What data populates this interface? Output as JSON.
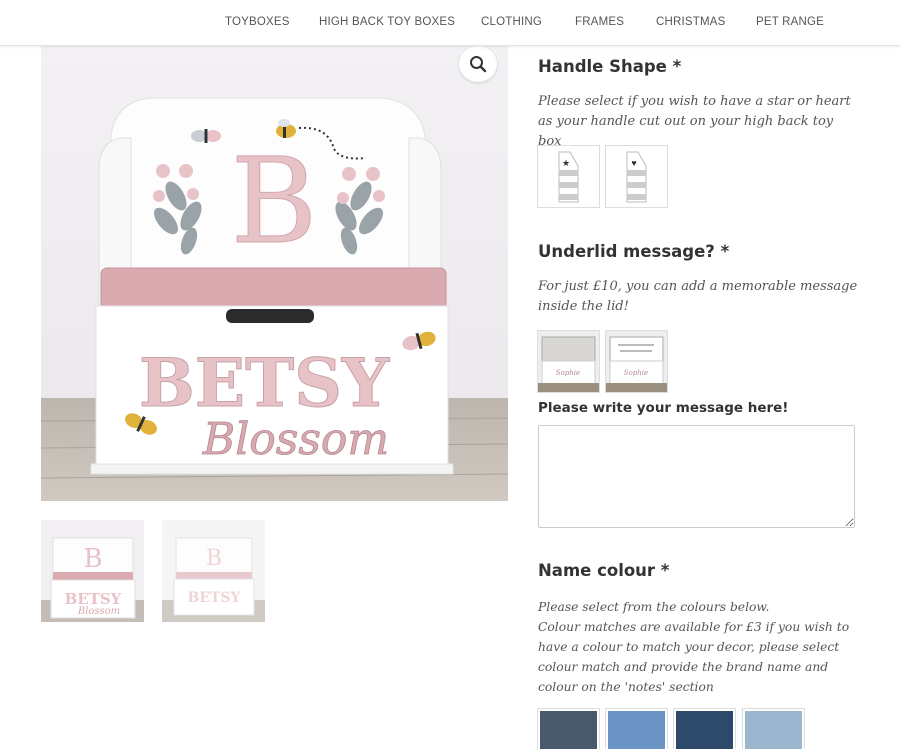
{
  "nav": {
    "items": [
      "TOYBOXES",
      "HIGH BACK TOY BOXES",
      "CLOTHING",
      "FRAMES",
      "CHRISTMAS",
      "PET RANGE"
    ]
  },
  "product_image": {
    "letter": "B",
    "name_main": "BETSY",
    "name_script": "Blossom"
  },
  "handle_shape": {
    "title": "Handle Shape *",
    "description": "Please select if you wish to have a star or heart as your handle cut out on your high back toy box",
    "options": [
      "star",
      "heart"
    ]
  },
  "underlid": {
    "title": "Underlid message? *",
    "description": "For just £10, you can add a memorable message inside the lid!",
    "message_label": "Please write your message here!",
    "message_value": ""
  },
  "name_colour": {
    "title": "Name colour *",
    "description_line1": "Please select from the colours below.",
    "description_rest": "Colour matches are available for £3 if you wish to have a colour to match your decor, please select colour match and provide the brand name and colour on the 'notes' section",
    "swatches": [
      "#4a5a6c",
      "#6b93c4",
      "#2e4a6a",
      "#9bb7cf"
    ]
  },
  "colors": {
    "pink": "#e7c3c8",
    "pink_dark": "#c99aa3",
    "seat": "#d9aab0"
  }
}
